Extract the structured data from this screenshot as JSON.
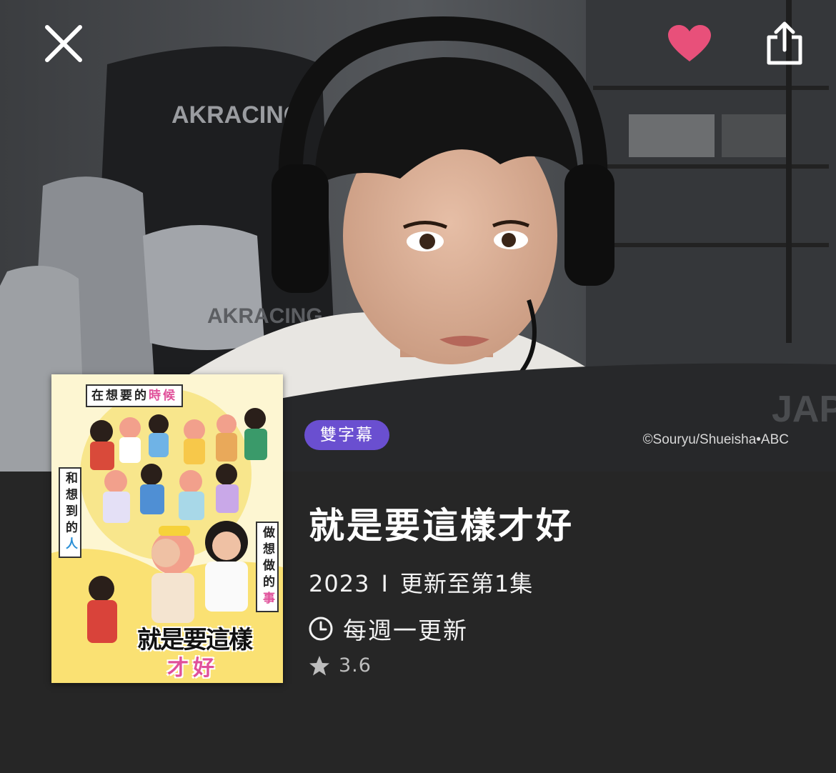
{
  "hero": {
    "badge": "雙字幕",
    "copyright": "©Souryu/Shueisha•ABC",
    "chair_text": "AKRACING",
    "monitor_text": "JAP"
  },
  "poster": {
    "top_text_a": "在想要的",
    "top_text_b": "時候",
    "left_text_a": "和想到的",
    "left_text_b": "人",
    "right_text_a": "做想做的",
    "right_text_b": "事",
    "logo_line1": "就是要這樣",
    "logo_line2": "才好"
  },
  "show": {
    "title": "就是要這樣才好",
    "year": "2023",
    "separator": "I",
    "episodes": "更新至第1集",
    "schedule": "每週一更新",
    "rating": "3.6"
  },
  "icons": {
    "close": "close-icon",
    "favorite": "heart-icon",
    "share": "share-icon",
    "clock": "clock-icon",
    "star": "star-icon"
  },
  "colors": {
    "heart": "#e8507a",
    "badge": "#6a4fd0",
    "background": "#262626"
  }
}
